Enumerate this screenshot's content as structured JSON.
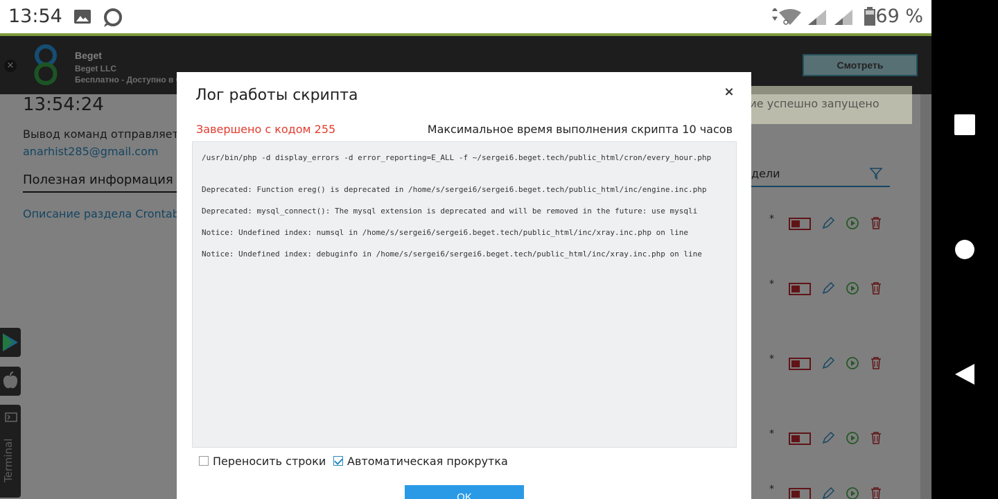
{
  "status_bar": {
    "time": "13:54",
    "battery": "69 %"
  },
  "app_banner": {
    "close": "×",
    "name": "Beget",
    "vendor": "Beget LLC",
    "price": "Бесплатно - Доступно в Google Play",
    "view_button": "Смотреть"
  },
  "toast": {
    "text": "Задание успешно запущено"
  },
  "background_page": {
    "time": "13:54:24",
    "output_text": "Вывод команд отправляется",
    "email": "anarhist285@gmail.com",
    "useful_info_heading": "Полезная информация",
    "crontab_link": "Описание раздела Crontab",
    "tab_label": "дели",
    "row_star": "*"
  },
  "modal": {
    "title": "Лог работы скрипта",
    "close": "×",
    "status": "Завершено с кодом 255",
    "max_time": "Максимальное время выполнения скрипта 10 часов",
    "log_lines": [
      "/usr/bin/php -d display_errors -d error_reporting=E_ALL -f ~/sergei6.beget.tech/public_html/cron/every_hour.php",
      "Deprecated: Function ereg() is deprecated in /home/s/sergei6/sergei6.beget.tech/public_html/inc/engine.inc.php",
      "Deprecated: mysql_connect(): The mysql extension is deprecated and will be removed in the future: use mysqli",
      "Notice: Undefined index: numsql in /home/s/sergei6/sergei6.beget.tech/public_html/inc/xray.inc.php on line",
      "Notice: Undefined index: debuginfo in /home/s/sergei6/sergei6.beget.tech/public_html/inc/xray.inc.php on line"
    ],
    "wrap_lines_label": "Переносить строки",
    "wrap_lines_checked": false,
    "autoscroll_label": "Автоматическая прокрутка",
    "autoscroll_checked": true,
    "ok_button": "OK"
  },
  "side_widgets": {
    "terminal_label": "Terminal"
  },
  "colors": {
    "accent_blue": "#2a9ae6",
    "error_red": "#e23b2d",
    "toggle_red": "#c0282d",
    "action_green": "#4caf50"
  }
}
